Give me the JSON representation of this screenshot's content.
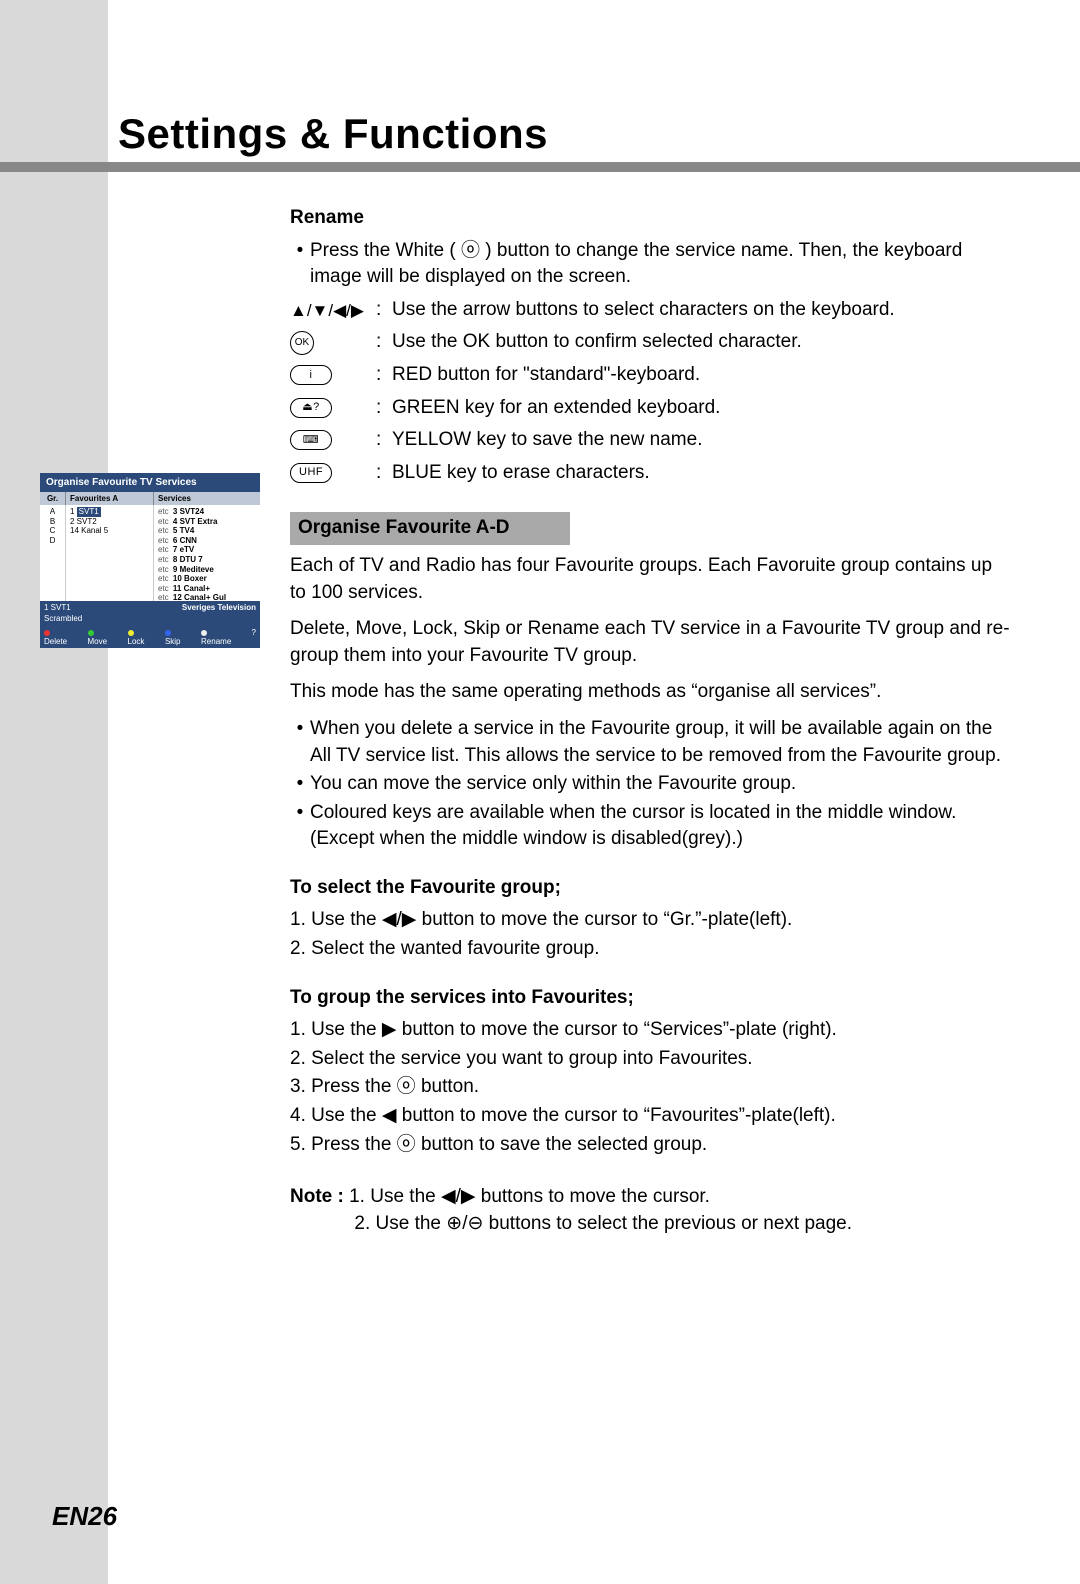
{
  "title": "Settings & Functions",
  "page_number": "EN26",
  "rename": {
    "heading": "Rename",
    "intro": "Press the White ( ⓞ ) button to change the service name. Then, the keyboard image will be displayed on the screen.",
    "defs": [
      {
        "key_glyph": "▲/▼/◀/▶",
        "key_type": "arrows",
        "text": "Use the arrow buttons to select characters on the keyboard."
      },
      {
        "key_glyph": "OK",
        "key_type": "ok",
        "text": "Use the OK button to confirm selected character."
      },
      {
        "key_glyph": "i",
        "key_type": "pill",
        "text": "RED button for \"standard\"-keyboard."
      },
      {
        "key_glyph": "⏏?",
        "key_type": "pill",
        "text": "GREEN key for an extended keyboard."
      },
      {
        "key_glyph": "⌨",
        "key_type": "pill",
        "text": "YELLOW key to save the new name."
      },
      {
        "key_glyph": "UHF",
        "key_type": "pill",
        "text": "BLUE key to erase characters."
      }
    ]
  },
  "organise": {
    "heading": "Organise Favourite A-D",
    "p1": "Each of TV and Radio has four Favourite groups. Each Favoruite group contains up to 100 services.",
    "p2": "Delete, Move, Lock, Skip or Rename each TV service in a Favourite TV group and re-group them into your Favourite TV group.",
    "p3": "This mode has the same operating methods as “organise all services”.",
    "bullets": [
      "When you delete a service in the Favourite group, it will be available again on the All TV service list. This allows the service to be removed from the Favourite group.",
      "You can move the service only within the Favourite group.",
      "Coloured keys are available when the cursor is located in the middle window. (Except when the middle window is disabled(grey).)"
    ]
  },
  "select_group": {
    "heading": "To select the Favourite group;",
    "steps": [
      "1. Use the ◀/▶ button to move the cursor to “Gr.”-plate(left).",
      "2. Select the wanted favourite group."
    ]
  },
  "group_services": {
    "heading": "To group the services into Favourites;",
    "steps": [
      "1. Use the ▶ button to move the cursor to “Services”-plate (right).",
      "2. Select the service you want to group into Favourites.",
      "3. Press the ⓞ button.",
      "4. Use the ◀ button to move the cursor to “Favourites”-plate(left).",
      "5. Press the ⓞ button to save the selected group."
    ],
    "press_ok_icon": "OK"
  },
  "note": {
    "label": "Note :",
    "items": [
      "1. Use the ◀/▶ buttons to move the cursor.",
      "2. Use the ⊕/⊖ buttons to select the previous or next page."
    ]
  },
  "osd": {
    "head": "Organise Favourite TV Services",
    "cols": {
      "c1": "Gr.",
      "c2": "Favourites A",
      "c3": "Services"
    },
    "groups": [
      "A",
      "B",
      "C",
      "D"
    ],
    "favs": [
      {
        "num": "1",
        "name": "SVT1",
        "sel": true
      },
      {
        "num": "2",
        "name": "SVT2"
      },
      {
        "num": "14",
        "name": "Kanal 5"
      }
    ],
    "services": [
      {
        "num": "3",
        "name": "SVT24"
      },
      {
        "num": "4",
        "name": "SVT Extra"
      },
      {
        "num": "5",
        "name": "TV4"
      },
      {
        "num": "6",
        "name": "CNN"
      },
      {
        "num": "7",
        "name": "eTV"
      },
      {
        "num": "8",
        "name": "DTU 7"
      },
      {
        "num": "9",
        "name": "Mediteve"
      },
      {
        "num": "10",
        "name": "Boxer"
      },
      {
        "num": "11",
        "name": "Canal+"
      },
      {
        "num": "12",
        "name": "Canal+ Gul"
      }
    ],
    "info_left": "1 SVT1",
    "info_right": "Sveriges Television",
    "scrambled": "Scrambled",
    "footer": [
      "Delete",
      "Move",
      "Lock",
      "Skip",
      "Rename",
      "?"
    ]
  }
}
